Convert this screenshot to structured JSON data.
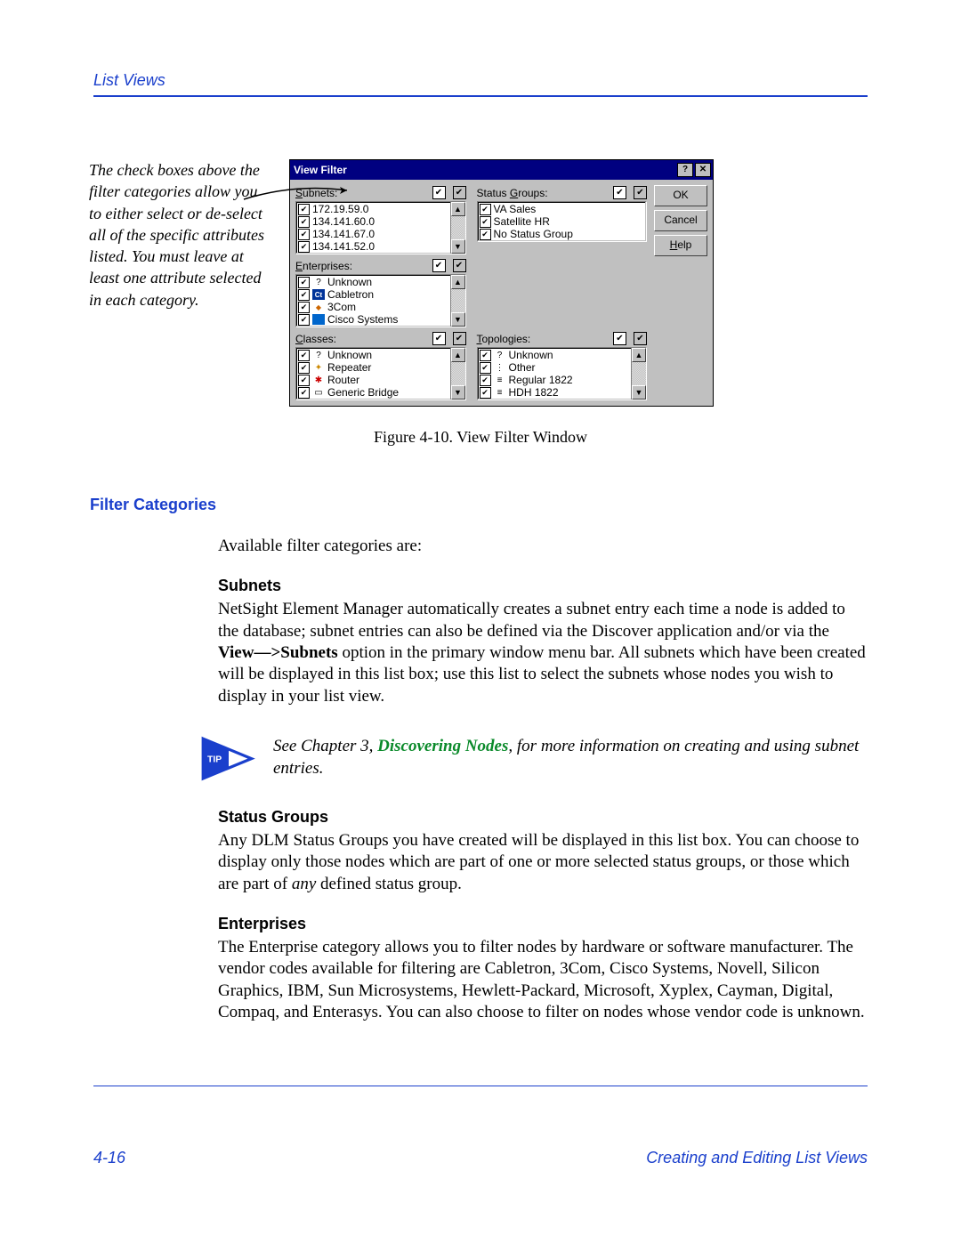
{
  "header": {
    "section": "List Views"
  },
  "annotation": "The check boxes above the filter categories allow you to either select or de-select all of the specific attributes listed. You must leave at least one attribute selected in each category.",
  "vf": {
    "title": "View Filter",
    "help_glyph": "?",
    "close_glyph": "✕",
    "buttons": {
      "ok": "OK",
      "cancel": "Cancel",
      "help": "Help"
    },
    "subnets": {
      "label": "Subnets:",
      "items": [
        "172.19.59.0",
        "134.141.60.0",
        "134.141.67.0",
        "134.141.52.0"
      ]
    },
    "status_groups": {
      "label": "Status Groups:",
      "items": [
        "VA Sales",
        "Satellite HR",
        "No Status Group"
      ]
    },
    "enterprises": {
      "label": "Enterprises:",
      "items": [
        "Unknown",
        "Cabletron",
        "3Com",
        "Cisco Systems"
      ]
    },
    "classes": {
      "label": "Classes:",
      "items": [
        "Unknown",
        "Repeater",
        "Router",
        "Generic Bridge"
      ]
    },
    "topologies": {
      "label": "Topologies:",
      "items": [
        "Unknown",
        "Other",
        "Regular 1822",
        "HDH 1822"
      ]
    }
  },
  "figure_caption": "Figure 4-10.  View Filter Window",
  "section_heading": "Filter Categories",
  "intro_para": "Available filter categories are:",
  "subnets_h": "Subnets",
  "subnets_p": "NetSight Element Manager automatically creates a subnet entry each time a node is added to the database; subnet entries can also be defined via the Discover application and/or via the View—>Subnets option in the primary window menu bar. All subnets which have been created will be displayed in this list box; use this list to select the subnets whose nodes you wish to display in your list view.",
  "subnets_bold": "View—>Subnets",
  "tip_label": "TIP",
  "tip_pre": "See Chapter 3, ",
  "tip_link": "Discovering Nodes",
  "tip_post": ", for more information on creating and using subnet entries.",
  "status_h": "Status Groups",
  "status_p": "Any DLM Status Groups you have created will be displayed in this list box. You can choose to display only those nodes which are part of one or more selected status groups, or those which are part of any defined status group.",
  "enterprises_h": "Enterprises",
  "enterprises_p": "The Enterprise category allows you to filter nodes by hardware or software manufacturer. The vendor codes available for filtering are Cabletron, 3Com, Cisco Systems, Novell, Silicon Graphics, IBM, Sun Microsystems, Hewlett-Packard, Microsoft, Xyplex, Cayman, Digital, Compaq, and Enterasys. You can also choose to filter on nodes whose vendor code is unknown.",
  "footer": {
    "page": "4-16",
    "title": "Creating and Editing List Views"
  }
}
